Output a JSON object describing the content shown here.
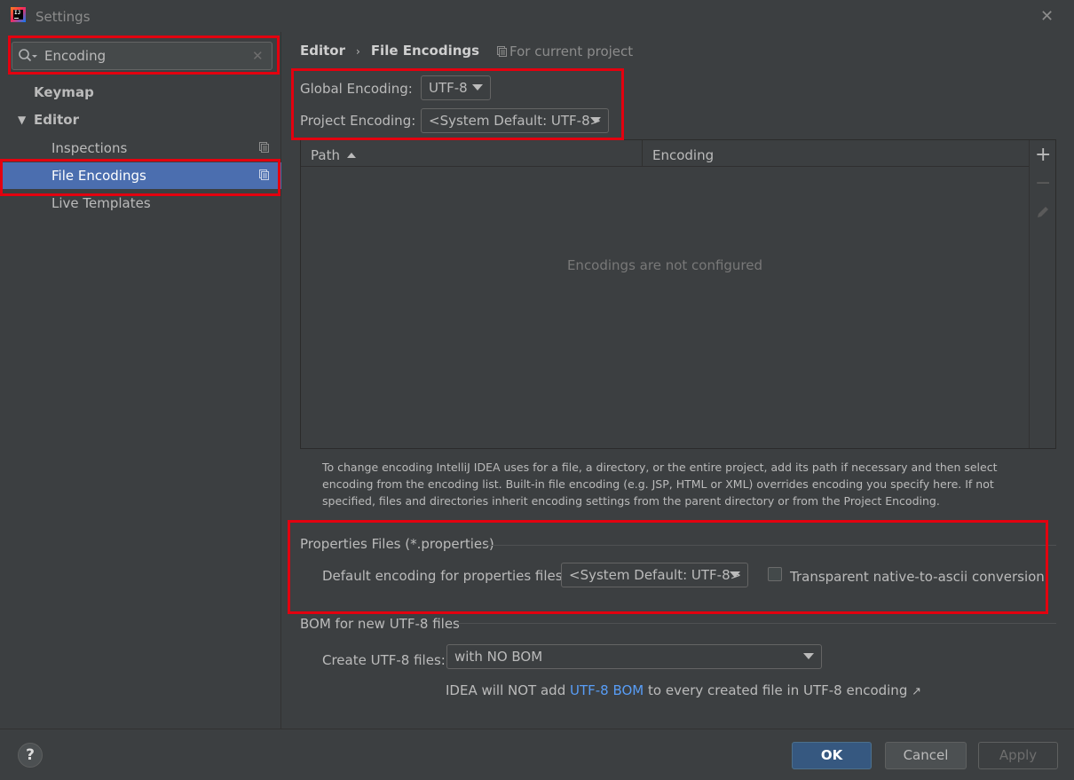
{
  "window": {
    "title": "Settings",
    "close_glyph": "✕"
  },
  "sidebar": {
    "search": {
      "value": "Encoding",
      "clear_glyph": "✕"
    },
    "items": [
      {
        "label": "Keymap"
      },
      {
        "label": "Editor"
      },
      {
        "label": "Inspections"
      },
      {
        "label": "File Encodings"
      },
      {
        "label": "Live Templates"
      }
    ]
  },
  "main": {
    "breadcrumb": {
      "parent": "Editor",
      "separator": "›",
      "current": "File Encodings"
    },
    "scope_note": "For current project",
    "global_encoding": {
      "label": "Global Encoding:",
      "value": "UTF-8"
    },
    "project_encoding": {
      "label": "Project Encoding:",
      "value": "<System Default: UTF-8>"
    },
    "table": {
      "columns": [
        "Path",
        "Encoding"
      ],
      "empty_text": "Encodings are not configured",
      "toolbar": {
        "add": "+",
        "remove": "−"
      }
    },
    "help_text": "To change encoding IntelliJ IDEA uses for a file, a directory, or the entire project, add its path if necessary and then select encoding from the encoding list. Built-in file encoding (e.g. JSP, HTML or XML) overrides encoding you specify here. If not specified, files and directories inherit encoding settings from the parent directory or from the Project Encoding.",
    "properties": {
      "title": "Properties Files (*.properties)",
      "default_label": "Default encoding for properties files:",
      "default_value": "<System Default: UTF-8>",
      "transparent_label": "Transparent native-to-ascii conversion",
      "transparent_checked": false
    },
    "bom": {
      "title": "BOM for new UTF-8 files",
      "create_label": "Create UTF-8 files:",
      "create_value": "with NO BOM",
      "note_prefix": "IDEA will NOT add ",
      "note_link": "UTF-8 BOM",
      "note_suffix": " to every created file in UTF-8 encoding",
      "note_arrow": "↗"
    }
  },
  "footer": {
    "help": "?",
    "ok": "OK",
    "cancel": "Cancel",
    "apply": "Apply"
  },
  "colors": {
    "background": "#3c3f41",
    "selection": "#4b6eaf",
    "primary_button": "#365880",
    "link": "#589df6",
    "highlight_box": "#e3000f"
  }
}
